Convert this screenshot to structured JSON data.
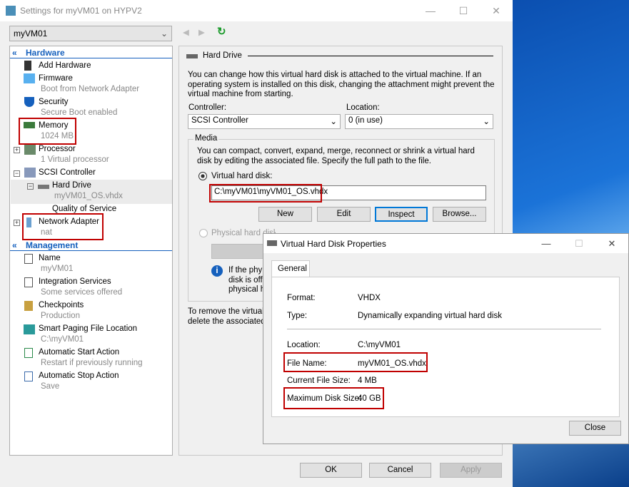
{
  "window": {
    "title": "Settings for myVM01 on HYPV2",
    "vm_selector": "myVM01"
  },
  "tree": {
    "hardware": "Hardware",
    "management": "Management",
    "items": [
      {
        "label": "Add Hardware"
      },
      {
        "label": "Firmware",
        "sub": "Boot from Network Adapter"
      },
      {
        "label": "Security",
        "sub": "Secure Boot enabled"
      },
      {
        "label": "Memory",
        "sub": "1024 MB"
      },
      {
        "label": "Processor",
        "sub": "1 Virtual processor"
      },
      {
        "label": "SCSI Controller"
      },
      {
        "label": "Hard Drive",
        "sub": "myVM01_OS.vhdx"
      },
      {
        "label": "Quality of Service"
      },
      {
        "label": "Network Adapter",
        "sub": "nat"
      },
      {
        "label": "Name",
        "sub": "myVM01"
      },
      {
        "label": "Integration Services",
        "sub": "Some services offered"
      },
      {
        "label": "Checkpoints",
        "sub": "Production"
      },
      {
        "label": "Smart Paging File Location",
        "sub": "C:\\myVM01"
      },
      {
        "label": "Automatic Start Action",
        "sub": "Restart if previously running"
      },
      {
        "label": "Automatic Stop Action",
        "sub": "Save"
      }
    ]
  },
  "panel": {
    "title": "Hard Drive",
    "desc": "You can change how this virtual hard disk is attached to the virtual machine. If an operating system is installed on this disk, changing the attachment might prevent the virtual machine from starting.",
    "controller_label": "Controller:",
    "controller": "SCSI Controller",
    "location_label": "Location:",
    "location": "0 (in use)",
    "media": "Media",
    "media_desc": "You can compact, convert, expand, merge, reconnect or shrink a virtual hard disk by editing the associated file. Specify the full path to the file.",
    "vhd_radio": "Virtual hard disk:",
    "vhd_path": "C:\\myVM01\\myVM01_OS.vhdx",
    "new": "New",
    "edit": "Edit",
    "inspect": "Inspect",
    "browse": "Browse...",
    "phys_radio": "Physical hard disk:",
    "info": [
      "If the phy",
      "disk is off",
      "physical h"
    ],
    "remove": [
      "To remove the virtual",
      "delete the associated"
    ]
  },
  "footer": {
    "ok": "OK",
    "cancel": "Cancel",
    "apply": "Apply"
  },
  "dialog": {
    "title": "Virtual Hard Disk Properties",
    "tab": "General",
    "format_label": "Format:",
    "format": "VHDX",
    "type_label": "Type:",
    "type": "Dynamically expanding virtual hard disk",
    "location_label": "Location:",
    "location": "C:\\myVM01",
    "file_label": "File Name:",
    "file": "myVM01_OS.vhdx",
    "size_label": "Current File Size:",
    "size": "4 MB",
    "max_label": "Maximum Disk Size:",
    "max": "40 GB",
    "close": "Close"
  },
  "colors": {
    "accent": "#1560bd",
    "highlight": "#c00000"
  }
}
